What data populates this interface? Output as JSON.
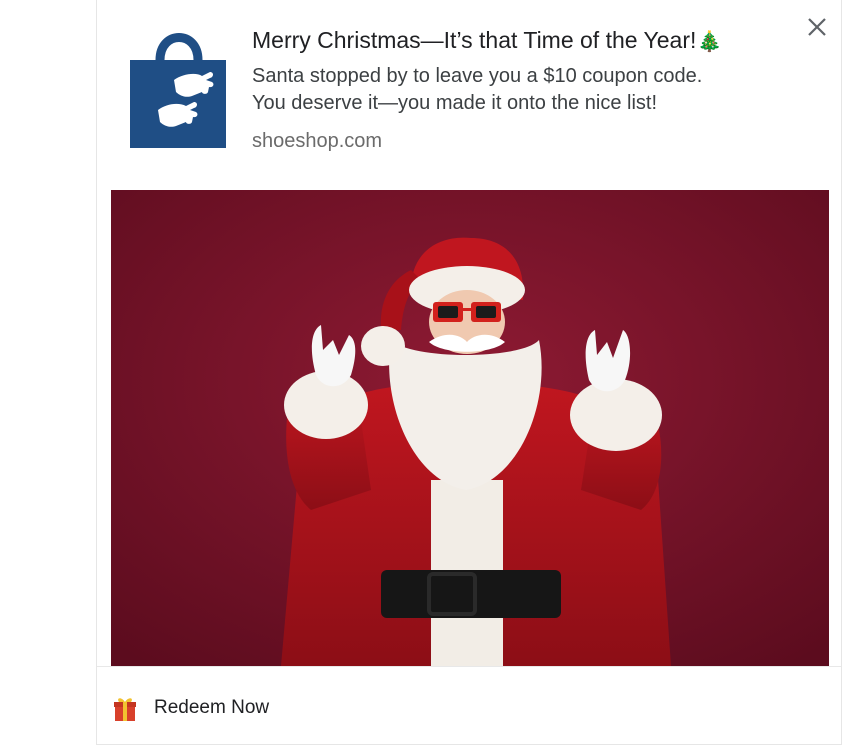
{
  "notification": {
    "title": "Merry Christmas—It’s that Time of the Year!",
    "title_emoji": "🎄",
    "body_line1": "Santa stopped by to leave you a $10 coupon code.",
    "body_line2": "You deserve it—you made it onto the nice list!",
    "domain": "shoeshop.com",
    "close_icon": "close-icon",
    "logo_icon": "shopping-bag-hug-icon",
    "image_subject": "santa-claus-photo",
    "action": {
      "label": "Redeem Now",
      "icon": "gift-icon"
    }
  },
  "colors": {
    "brand": "#1f4e85",
    "background_photo": "#7a1128",
    "text_primary": "#202124",
    "text_secondary": "#6b6b6b"
  }
}
